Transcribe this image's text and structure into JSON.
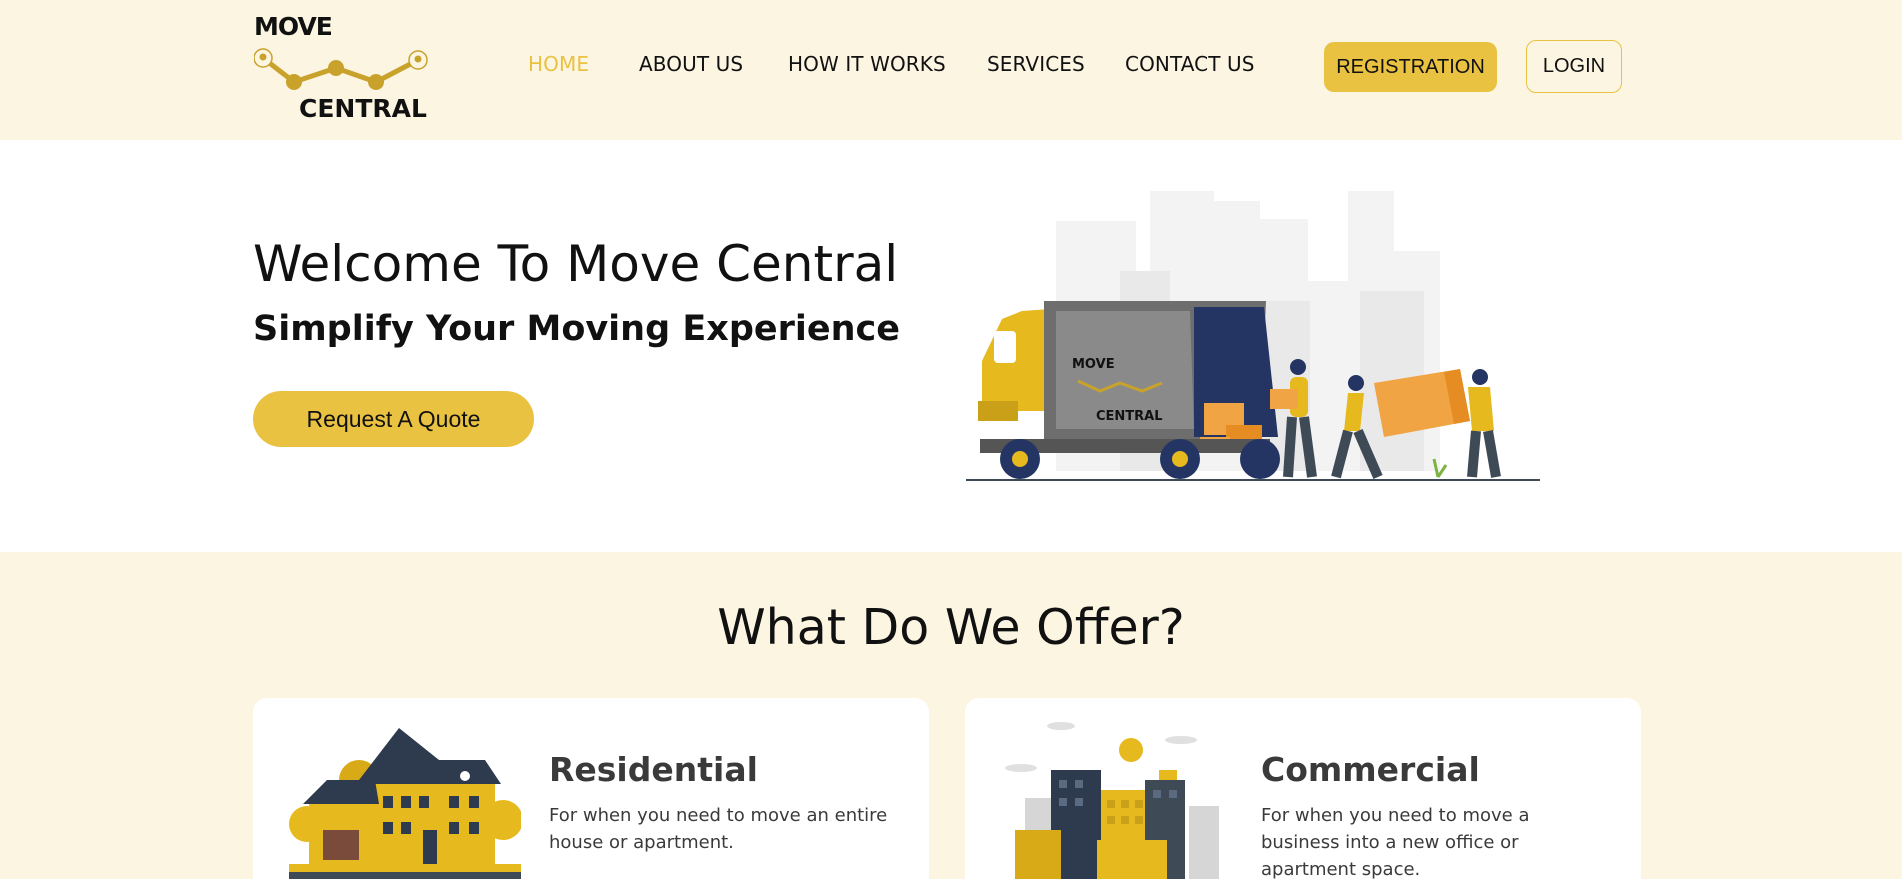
{
  "brand": {
    "logo_top": "MOVE",
    "logo_bottom": "CENTRAL",
    "accent_color": "#e9c242",
    "header_bg": "#fcf5e2"
  },
  "nav": {
    "items": [
      {
        "label": "HOME",
        "active": true
      },
      {
        "label": "ABOUT US",
        "active": false
      },
      {
        "label": "HOW IT WORKS",
        "active": false
      },
      {
        "label": "SERVICES",
        "active": false
      },
      {
        "label": "CONTACT US",
        "active": false
      }
    ],
    "register_label": "REGISTRATION",
    "login_label": "LOGIN"
  },
  "hero": {
    "title": "Welcome To Move Central",
    "subtitle": "Simplify Your Moving Experience",
    "cta_label": "Request A Quote",
    "truck_logo_top": "MOVE",
    "truck_logo_bottom": "CENTRAL"
  },
  "offer": {
    "title": "What Do We Offer?",
    "cards": [
      {
        "title": "Residential",
        "description": "For when you need to move an entire house or apartment.",
        "icon": "house-illustration"
      },
      {
        "title": "Commercial",
        "description": "For when you need to move a business into a new office or apartment space.",
        "icon": "city-buildings-illustration"
      }
    ]
  }
}
